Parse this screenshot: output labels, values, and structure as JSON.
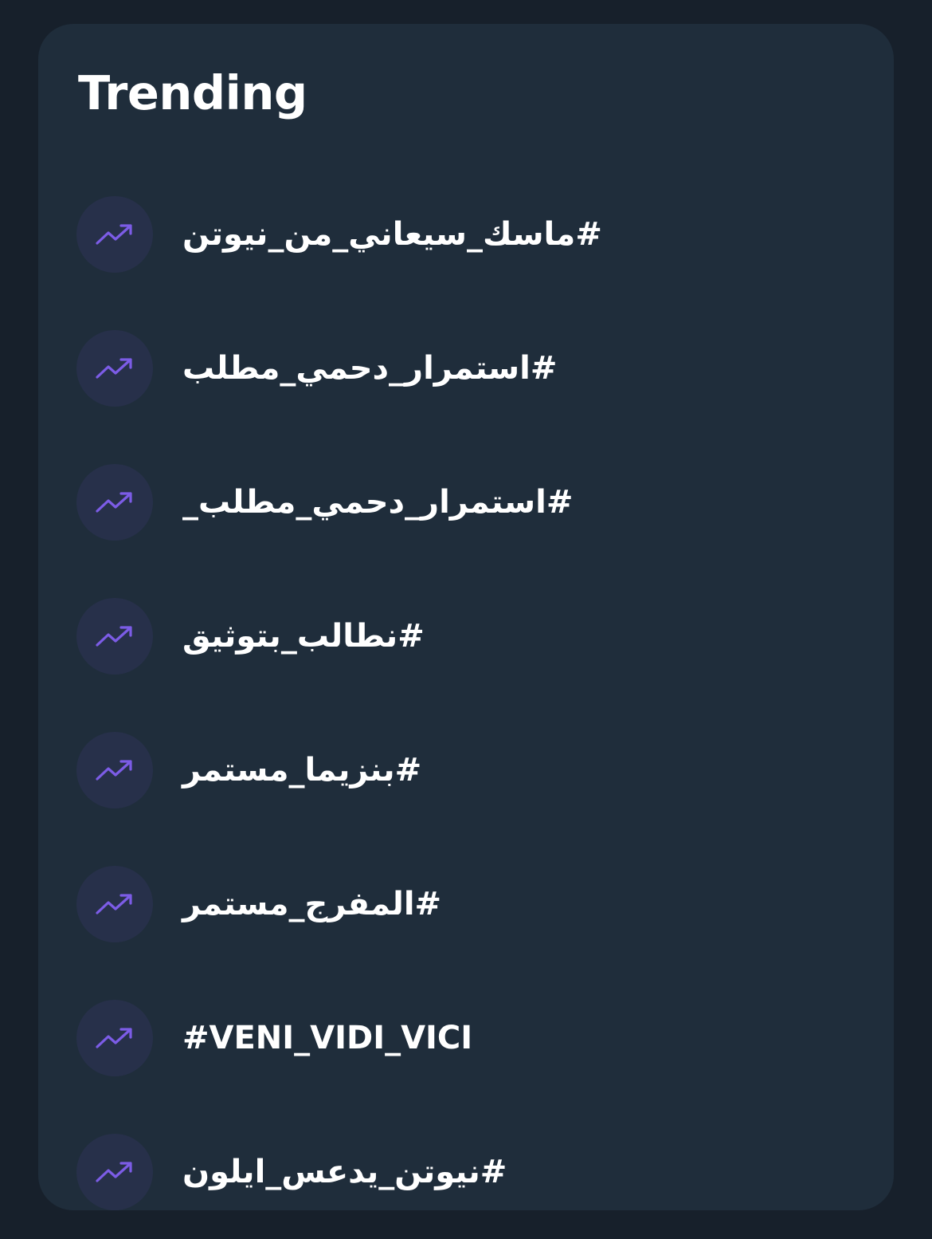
{
  "panel": {
    "title": "Trending",
    "accent_color": "#7c5ce6",
    "background_color": "#1f2d3b",
    "icon_bg_color": "#27304a",
    "item_icon": "trending-up-icon"
  },
  "trends": [
    {
      "tag": "#ماسك_سيعاني_من_نيوتن"
    },
    {
      "tag": "#استمرار_دحمي_مطلب"
    },
    {
      "tag": "#استمرار_دحمي_مطلب_"
    },
    {
      "tag": "#نطالب_بتوثيق"
    },
    {
      "tag": "#بنزيما_مستمر"
    },
    {
      "tag": "#المفرج_مستمر"
    },
    {
      "tag": "#VENI_VIDI_VICI"
    },
    {
      "tag": "#نيوتن_يدعس_ايلون"
    }
  ]
}
